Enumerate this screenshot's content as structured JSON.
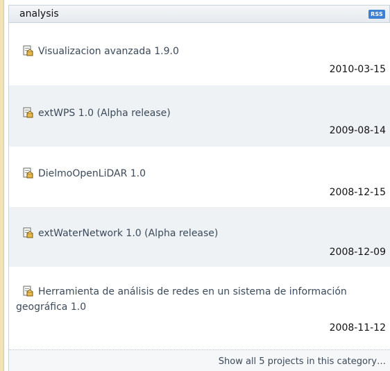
{
  "category": {
    "title": "analysis",
    "rss_label": "RSS"
  },
  "projects": [
    {
      "name": "Visualizacion avanzada 1.9.0",
      "date": "2010-03-15"
    },
    {
      "name": "extWPS 1.0 (Alpha release)",
      "date": "2009-08-14"
    },
    {
      "name": "DielmoOpenLiDAR 1.0",
      "date": "2008-12-15"
    },
    {
      "name": "extWaterNetwork 1.0 (Alpha release)",
      "date": "2008-12-09"
    },
    {
      "name": "Herramienta de análisis de redes en un sistema de información geográfica 1.0",
      "date": "2008-11-12"
    }
  ],
  "footer": {
    "show_all_label": "Show all 5 projects in this category…"
  },
  "icons": {
    "project": "package-icon",
    "feed": "rss-icon"
  },
  "colors": {
    "alt_row": "#eef2f5",
    "rss": "#3d7fd1",
    "link": "#3b4a5a"
  }
}
